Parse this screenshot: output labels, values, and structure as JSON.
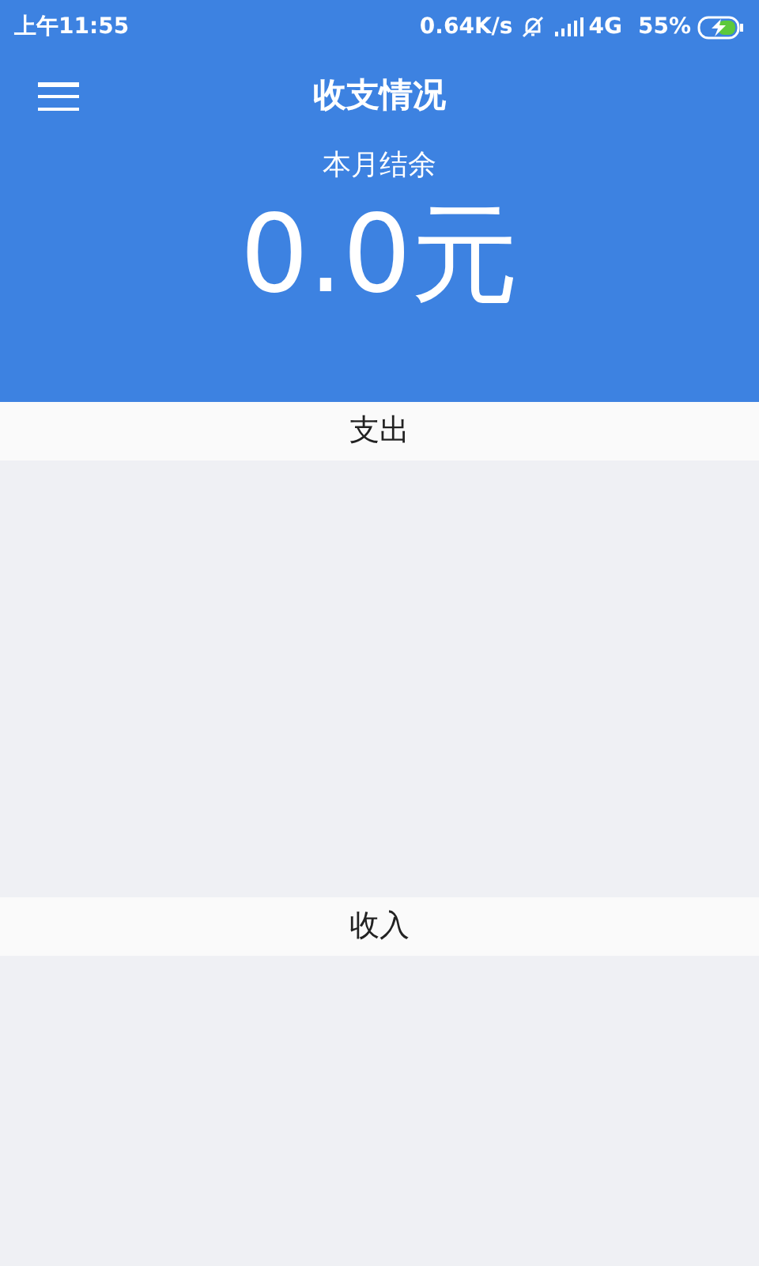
{
  "status_bar": {
    "time": "上午11:55",
    "speed": "0.64K/s",
    "network": "4G",
    "battery": "55%"
  },
  "app_bar": {
    "title": "收支情况"
  },
  "summary": {
    "label": "本月结余",
    "amount": "0.0元"
  },
  "sections": [
    {
      "title": "支出"
    },
    {
      "title": "收入"
    }
  ]
}
